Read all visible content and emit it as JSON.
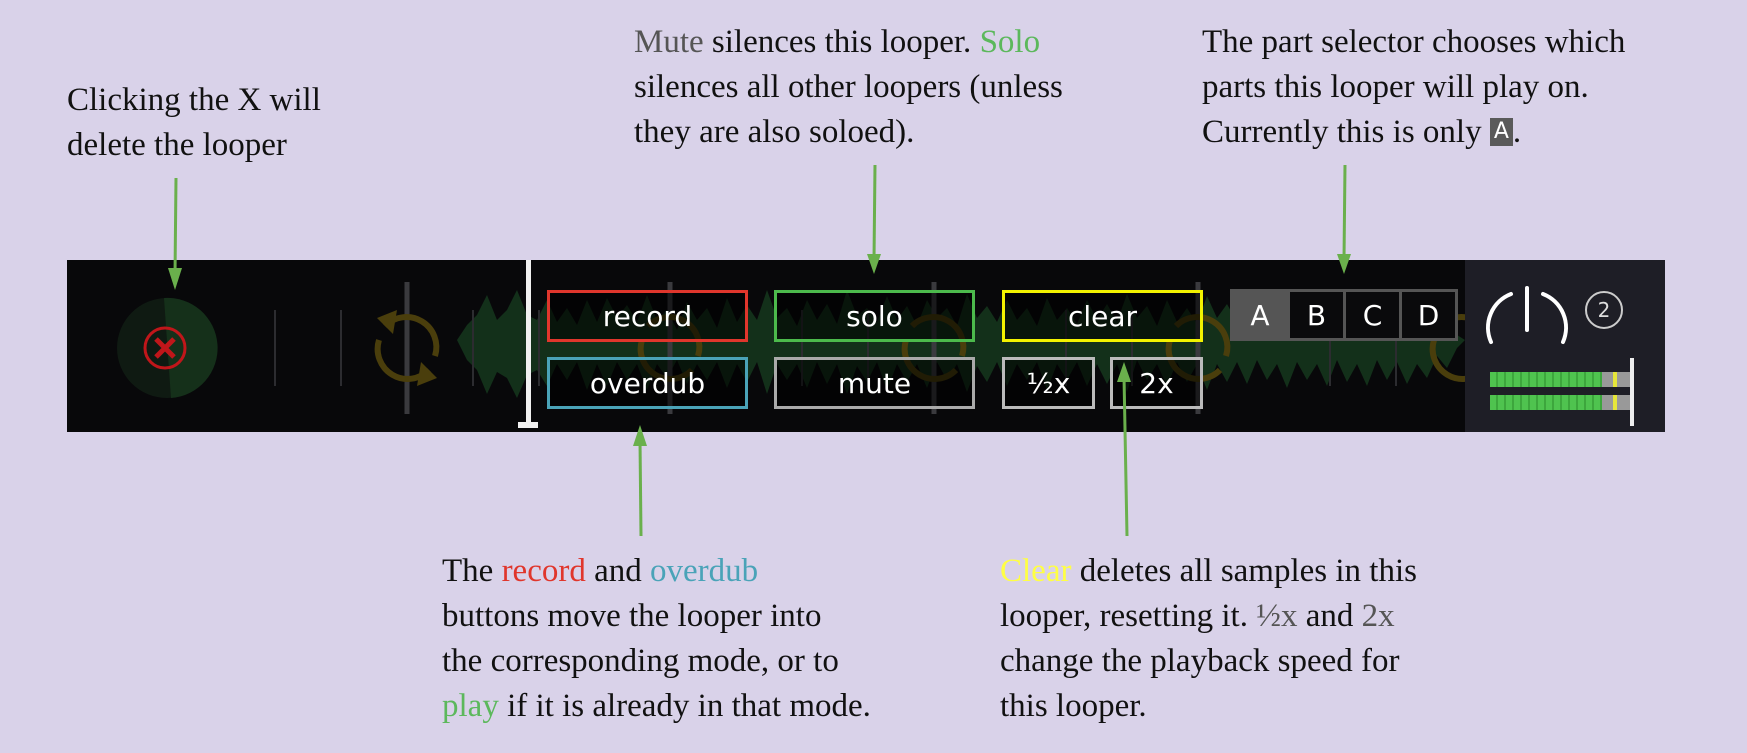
{
  "annotations": {
    "delete": {
      "line1": "Clicking the X will",
      "line2": "delete the looper"
    },
    "mute_solo": {
      "mute_word": "Mute",
      "line1_rest": " silences this looper. ",
      "solo_word": "Solo",
      "line2": "silences all other loopers (unless",
      "line3": "they are also soloed)."
    },
    "parts": {
      "line1": "The part selector chooses which",
      "line2": "parts this looper will play on.",
      "line3_pre": "Currently this is only ",
      "part_badge": "A",
      "line3_post": "."
    },
    "record_overdub": {
      "the": "The ",
      "record_word": "record",
      "and": " and ",
      "overdub_word": "overdub",
      "line2": "buttons move the looper into",
      "line3": "the corresponding mode, or to",
      "play_word": "play",
      "line4_rest": " if it is already in that mode."
    },
    "clear_speed": {
      "clear_word": "Clear",
      "line1_rest": " deletes all samples in this",
      "line2_pre": "looper, resetting it. ",
      "half_word": "½x",
      "and": " and ",
      "double_word": "2x",
      "line3": "change the playback speed for",
      "line4": "this looper."
    }
  },
  "looper": {
    "buttons": {
      "record": "record",
      "overdub": "overdub",
      "solo": "solo",
      "mute": "mute",
      "clear": "clear",
      "half": "½x",
      "double": "2x"
    },
    "parts": [
      {
        "label": "A",
        "active": true
      },
      {
        "label": "B",
        "active": false
      },
      {
        "label": "C",
        "active": false
      },
      {
        "label": "D",
        "active": false
      }
    ],
    "lane_number": "2",
    "meters": [
      {
        "level": 0.8,
        "peak": 0.88
      },
      {
        "level": 0.8,
        "peak": 0.88
      }
    ],
    "colors": {
      "record": "#e0362c",
      "overdub": "#4aa3b8",
      "solo": "#4cba4c",
      "mute": "#aaaaaa",
      "clear": "#f2f200",
      "speed": "#bbbbbb",
      "arrow": "#6ab04c"
    }
  }
}
